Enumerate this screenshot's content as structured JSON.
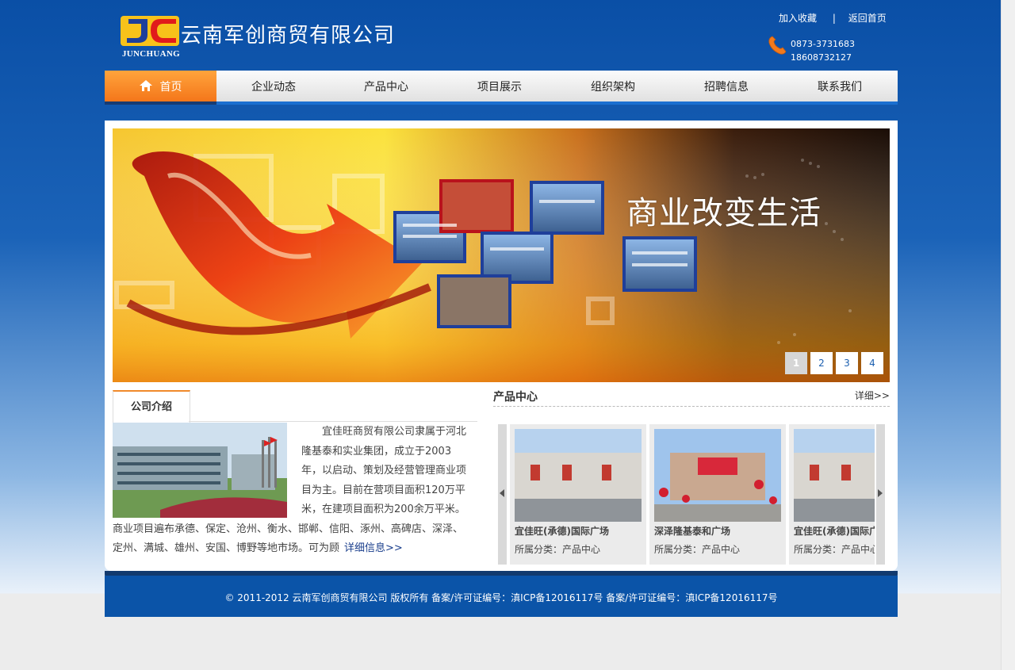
{
  "header": {
    "company_name": "云南军创商贸有限公司",
    "logo_text": "JUNCHUANG",
    "links": {
      "bookmark": "加入收藏",
      "separator": "|",
      "home": "返回首页"
    },
    "phones": [
      "0873-3731683",
      "18608732127"
    ]
  },
  "nav": {
    "items": [
      {
        "label": "首页",
        "active": true
      },
      {
        "label": "企业动态"
      },
      {
        "label": "产品中心"
      },
      {
        "label": "项目展示"
      },
      {
        "label": "组织架构"
      },
      {
        "label": "招聘信息"
      },
      {
        "label": "联系我们"
      }
    ]
  },
  "banner": {
    "slogan": "商业改变生活",
    "pages": [
      "1",
      "2",
      "3",
      "4"
    ],
    "current_page": "1"
  },
  "intro": {
    "tab_label": "公司介绍",
    "text": "宜佳旺商贸有限公司隶属于河北隆基泰和实业集团，成立于2003年，以启动、策划及经营管理商业项目为主。目前在营项目面积120万平米，在建项目面积为200余万平米。商业项目遍布承德、保定、沧州、衡水、邯郸、信阳、涿州、高碑店、深泽、定州、满城、雄州、安国、博野等地市场。可为顾",
    "more_link": "详细信息>>"
  },
  "products": {
    "title": "产品中心",
    "more": "详细>>",
    "cards": [
      {
        "name": "宜佳旺(承德)国际广场",
        "category": "所属分类：产品中心"
      },
      {
        "name": "深泽隆基泰和广场",
        "category": "所属分类：产品中心"
      },
      {
        "name": "宜佳旺(承德)国际广场",
        "category": "所属分类：产品中心"
      }
    ]
  },
  "footer": {
    "text": "© 2011-2012 云南军创商贸有限公司 版权所有   备案/许可证编号：滇ICP备12016117号 备案/许可证编号：滇ICP备12016117号"
  },
  "colors": {
    "primary_blue": "#0b54a8",
    "nav_active_orange": "#f4761a",
    "accent_orange": "#f08a2b"
  }
}
